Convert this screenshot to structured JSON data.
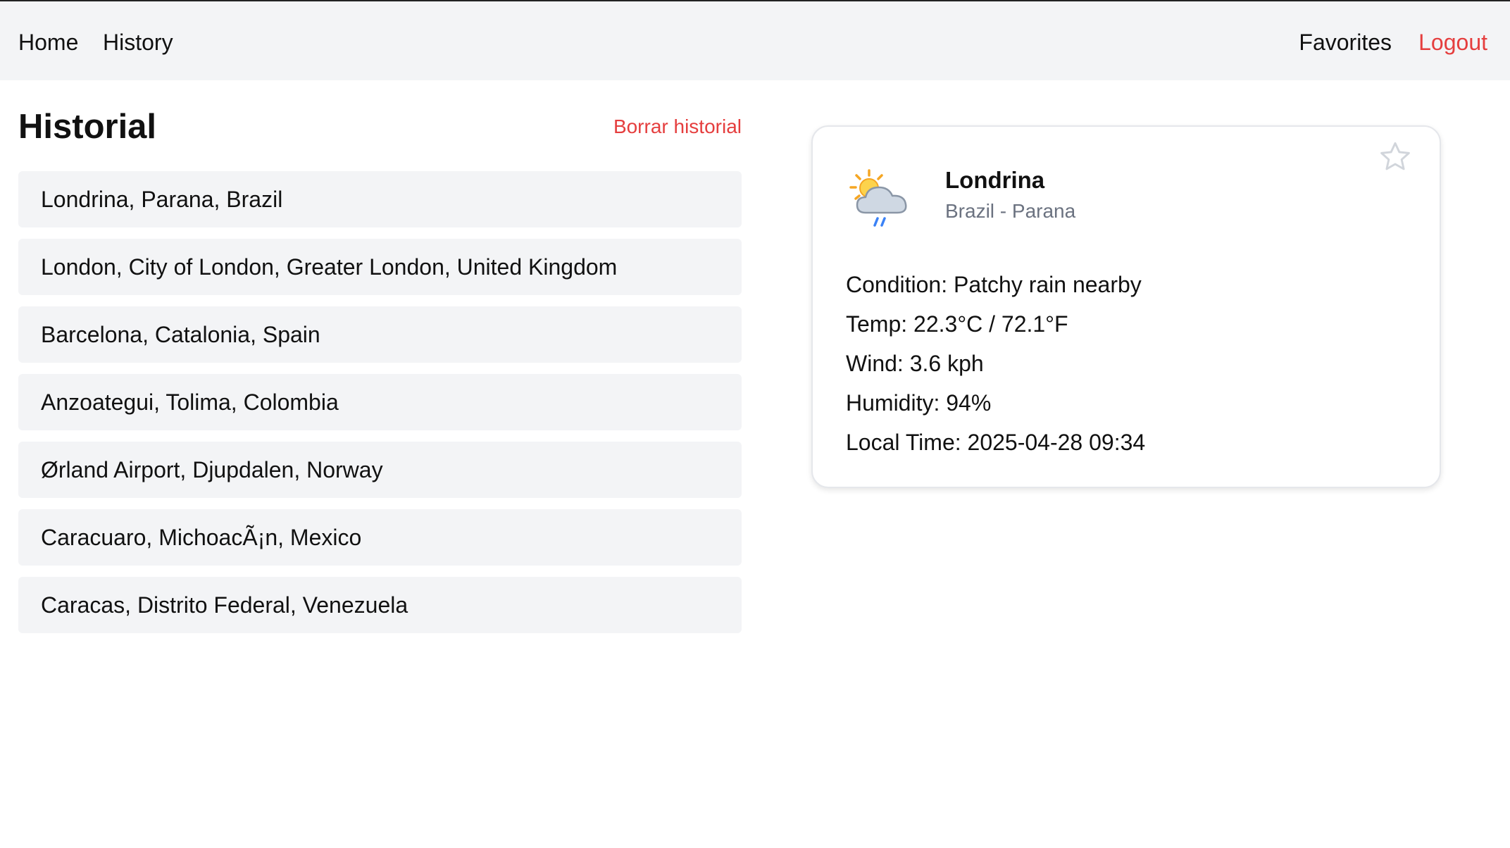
{
  "nav": {
    "home": "Home",
    "history": "History",
    "favorites": "Favorites",
    "logout": "Logout"
  },
  "history": {
    "title": "Historial",
    "clear_label": "Borrar historial",
    "items": [
      "Londrina, Parana, Brazil",
      "London, City of London, Greater London, United Kingdom",
      "Barcelona, Catalonia, Spain",
      "Anzoategui, Tolima, Colombia",
      "Ørland Airport, Djupdalen, Norway",
      "Caracuaro, MichoacÃ¡n, Mexico",
      "Caracas, Distrito Federal, Venezuela"
    ]
  },
  "weather": {
    "city": "Londrina",
    "region": "Brazil - Parana",
    "icon": "patchy-rain-icon",
    "favorite_icon": "star-outline-icon",
    "details": [
      "Condition: Patchy rain nearby",
      "Temp: 22.3°C / 72.1°F",
      "Wind: 3.6 kph",
      "Humidity: 94%",
      "Local Time: 2025-04-28 09:34"
    ]
  },
  "colors": {
    "accent_red": "#e53e3e",
    "nav_background": "#f3f4f6",
    "item_background": "#f3f4f6",
    "muted_text": "#6b7280"
  }
}
